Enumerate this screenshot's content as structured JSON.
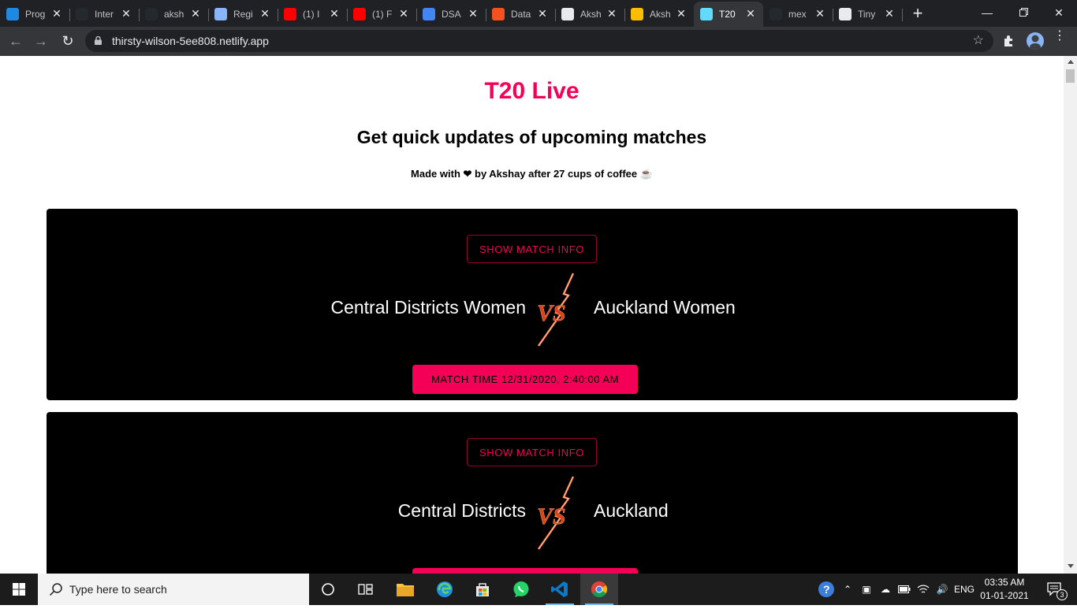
{
  "browser": {
    "tabs": [
      {
        "title": "Prog",
        "favicon": "ib-icon",
        "color": "#1e88e5"
      },
      {
        "title": "Inter",
        "favicon": "github-icon",
        "color": "#24292e"
      },
      {
        "title": "aksh",
        "favicon": "github-icon",
        "color": "#24292e"
      },
      {
        "title": "Regi",
        "favicon": "shield-icon",
        "color": "#8ab4f8"
      },
      {
        "title": "(1) I",
        "favicon": "youtube-icon",
        "color": "#ff0000"
      },
      {
        "title": "(1) F",
        "favicon": "youtube-icon",
        "color": "#ff0000"
      },
      {
        "title": "DSA",
        "favicon": "docs-icon",
        "color": "#4285f4"
      },
      {
        "title": "Data",
        "favicon": "data-icon",
        "color": "#f4511e"
      },
      {
        "title": "Aksh",
        "favicon": "globe-icon",
        "color": "#e8eaed"
      },
      {
        "title": "Aksh",
        "favicon": "drive-icon",
        "color": "#fbbc04"
      },
      {
        "title": "T20",
        "favicon": "react-icon",
        "color": "#61dafb",
        "active": true
      },
      {
        "title": "mex",
        "favicon": "github-icon",
        "color": "#24292e"
      },
      {
        "title": "Tiny",
        "favicon": "tinypng-icon",
        "color": "#e8eaed"
      }
    ],
    "url": "thirsty-wilson-5ee808.netlify.app"
  },
  "page": {
    "title": "T20 Live",
    "subtitle": "Get quick updates of upcoming matches",
    "made_with": "Made with ❤ by Akshay after 27 cups of coffee ☕",
    "accent": "#f50057"
  },
  "matches": [
    {
      "info_label": "SHOW MATCH INFO",
      "team1": "Central Districts Women",
      "team2": "Auckland Women",
      "time_label": "MATCH TIME 12/31/2020, 2:40:00 AM"
    },
    {
      "info_label": "SHOW MATCH INFO",
      "team1": "Central Districts",
      "team2": "Auckland",
      "time_label": ""
    }
  ],
  "taskbar": {
    "search_placeholder": "Type here to search",
    "language": "ENG",
    "time": "03:35 AM",
    "date": "01-01-2021",
    "notification_count": "3"
  }
}
